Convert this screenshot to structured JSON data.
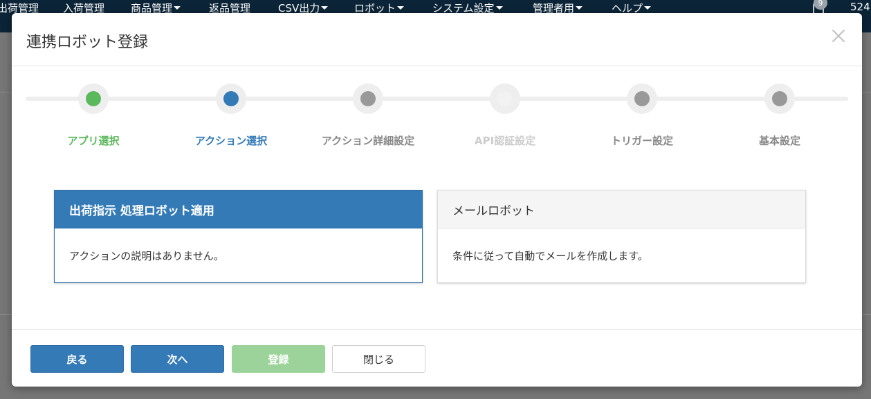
{
  "nav": {
    "items": [
      {
        "label": "出荷管理",
        "dropdown": false
      },
      {
        "label": "入荷管理",
        "dropdown": false
      },
      {
        "label": "商品管理",
        "dropdown": true
      },
      {
        "label": "返品管理",
        "dropdown": false
      },
      {
        "label": "CSV出力",
        "dropdown": true
      },
      {
        "label": "ロボット",
        "dropdown": true
      },
      {
        "label": "システム設定",
        "dropdown": true
      },
      {
        "label": "管理者用",
        "dropdown": true
      },
      {
        "label": "ヘルプ",
        "dropdown": true
      }
    ],
    "notification_count": "9",
    "right_text": "524"
  },
  "modal": {
    "title": "連携ロボット登録",
    "steps": [
      {
        "label": "アプリ選択",
        "state": "done",
        "dot_color": "#5cb85c",
        "label_color": "#5cb85c"
      },
      {
        "label": "アクション選択",
        "state": "current",
        "dot_color": "#337ab7",
        "label_color": "#337ab7"
      },
      {
        "label": "アクション詳細設定",
        "state": "pending",
        "dot_color": "#999999",
        "label_color": "#888888"
      },
      {
        "label": "API認証設定",
        "state": "disabled",
        "dot_color": "#f2f2f2",
        "label_color": "#cccccc"
      },
      {
        "label": "トリガー設定",
        "state": "pending",
        "dot_color": "#999999",
        "label_color": "#888888"
      },
      {
        "label": "基本設定",
        "state": "pending",
        "dot_color": "#999999",
        "label_color": "#888888"
      }
    ],
    "actions": [
      {
        "title": "出荷指示 処理ロボット適用",
        "description": "アクションの説明はありません。",
        "selected": true
      },
      {
        "title": "メールロボット",
        "description": "条件に従って自動でメールを作成します。",
        "selected": false
      }
    ],
    "buttons": {
      "back": "戻る",
      "next": "次へ",
      "register": "登録",
      "close": "閉じる"
    }
  }
}
